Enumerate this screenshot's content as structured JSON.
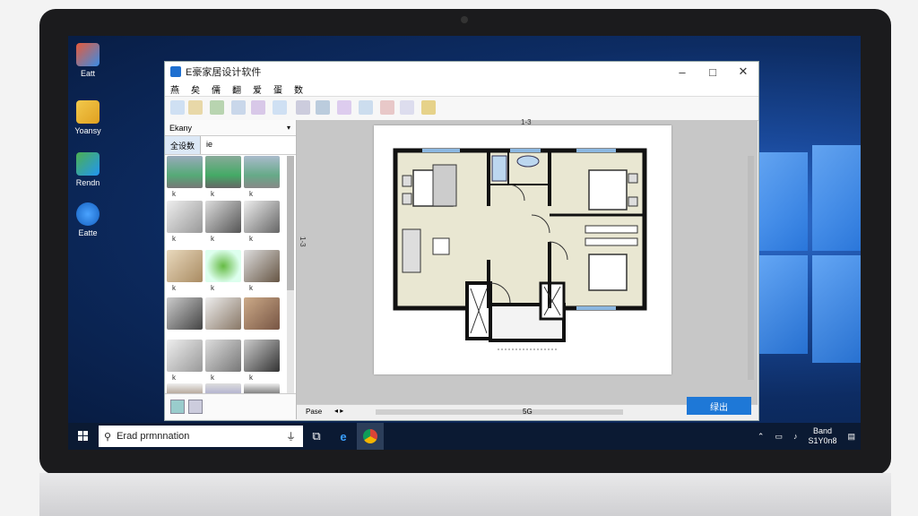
{
  "desktop": {
    "icons": [
      {
        "label": "Eatt"
      },
      {
        "label": "Yoansy"
      },
      {
        "label": "Rendn"
      },
      {
        "label": "Eatte"
      }
    ]
  },
  "window": {
    "title": "E豪家居设计软件",
    "controls": {
      "minimize": "–",
      "maximize": "□",
      "close": "✕"
    },
    "menu": [
      "燕",
      "矣",
      "儒",
      "翻",
      "爱",
      "蛋",
      "数"
    ],
    "left_panel": {
      "header": "Ekany",
      "tabs": [
        {
          "label": "全设数"
        },
        {
          "label": "ie"
        }
      ],
      "thumbs": [
        {
          "label": "k"
        },
        {
          "label": "k"
        },
        {
          "label": "k"
        },
        {
          "label": "k"
        },
        {
          "label": "k"
        },
        {
          "label": "k"
        },
        {
          "label": "k"
        },
        {
          "label": "k"
        },
        {
          "label": "k"
        },
        {
          "label": "k"
        },
        {
          "label": "k"
        },
        {
          "label": "k"
        }
      ]
    },
    "canvas": {
      "top_ruler": "1-3",
      "left_ruler": "1-3",
      "status_left": "Pase",
      "status_mid": "5G",
      "ok_button": "绿出"
    }
  },
  "taskbar": {
    "search_placeholder": "Erad prmnnation",
    "tray_top": "Band",
    "tray_bottom": "S1Y0n8"
  }
}
